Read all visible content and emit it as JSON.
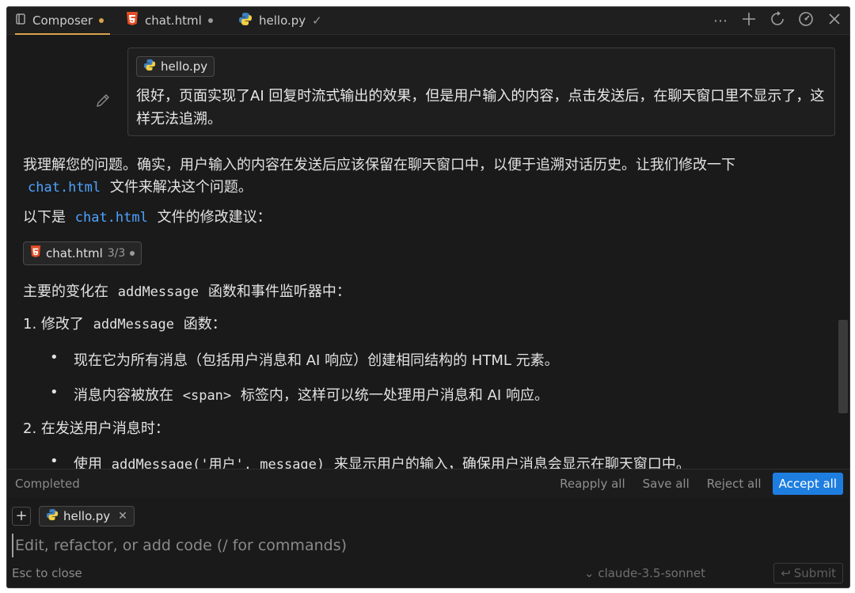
{
  "tabs": [
    {
      "label": "Composer",
      "icon": "composer-icon"
    },
    {
      "label": "chat.html",
      "icon": "html5-icon"
    },
    {
      "label": "hello.py",
      "icon": "python-icon"
    }
  ],
  "tab_actions": [
    "more-icon",
    "plus-icon",
    "refresh-icon",
    "gauge-icon",
    "close-icon"
  ],
  "user_message": {
    "chip": "hello.py",
    "text": "很好，页面实现了AI 回复时流式输出的效果，但是用户输入的内容，点击发送后，在聊天窗口里不显示了，这样无法追溯。"
  },
  "response": {
    "p1_a": "我理解您的问题。确实，用户输入的内容在发送后应该保留在聊天窗口中，以便于追溯对话历史。让我们修改一下",
    "p1_code": "chat.html",
    "p1_b": "文件来解决这个问题。",
    "p2_a": "以下是",
    "p2_code": "chat.html",
    "p2_b": "文件的修改建议：",
    "code_chip": {
      "label": "chat.html",
      "count": "3/3"
    },
    "p3_a": "主要的变化在",
    "p3_code": "addMessage",
    "p3_b": "函数和事件监听器中：",
    "item1_a": "1. 修改了",
    "item1_code": "addMessage",
    "item1_b": "函数：",
    "b1": "现在它为所有消息（包括用户消息和 AI 响应）创建相同结构的 HTML 元素。",
    "b2_a": "消息内容被放在",
    "b2_code": "<span>",
    "b2_b": "标签内，这样可以统一处理用户消息和 AI 响应。",
    "item2": "2. 在发送用户消息时：",
    "b3_a": "使用",
    "b3_code": "addMessage('用户', message)",
    "b3_b": "来显示用户的输入，确保用户消息会显示在聊天窗口中。"
  },
  "status": {
    "label": "Completed",
    "reapply": "Reapply all",
    "save": "Save all",
    "reject": "Reject all",
    "accept": "Accept all"
  },
  "input": {
    "chip": "hello.py",
    "placeholder": "Edit, refactor, or add code (/ for commands)",
    "esc": "Esc to close",
    "model": "claude-3.5-sonnet",
    "submit": "Submit"
  },
  "colors": {
    "accent": "#1e7ee0",
    "tab_indicator": "#d8a24a",
    "code": "#4ea3ff",
    "html5": "#e44d26"
  }
}
